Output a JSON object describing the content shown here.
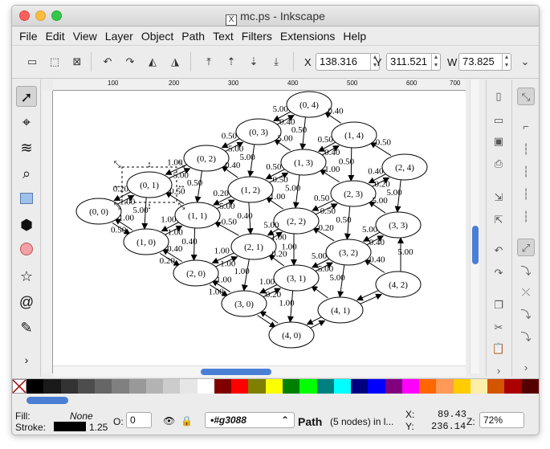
{
  "window": {
    "title": "mc.ps - Inkscape"
  },
  "menu": [
    "File",
    "Edit",
    "View",
    "Layer",
    "Object",
    "Path",
    "Text",
    "Filters",
    "Extensions",
    "Help"
  ],
  "toolbar": {
    "x_label": "X",
    "x_value": "138.316",
    "y_label": "Y",
    "y_value": "311.521",
    "w_label": "W",
    "w_value": "73.825"
  },
  "ruler_ticks": [
    "100",
    "200",
    "300",
    "400",
    "500",
    "600",
    "700"
  ],
  "graph": {
    "nodes": [
      {
        "id": "n04",
        "label": "(0, 4)"
      },
      {
        "id": "n03",
        "label": "(0, 3)"
      },
      {
        "id": "n14",
        "label": "(1, 4)"
      },
      {
        "id": "n02",
        "label": "(0, 2)"
      },
      {
        "id": "n13",
        "label": "(1, 3)"
      },
      {
        "id": "n24",
        "label": "(2, 4)"
      },
      {
        "id": "n01",
        "label": "(0, 1)"
      },
      {
        "id": "n12",
        "label": "(1, 2)"
      },
      {
        "id": "n23",
        "label": "(2, 3)"
      },
      {
        "id": "n00",
        "label": "(0, 0)"
      },
      {
        "id": "n11",
        "label": "(1, 1)"
      },
      {
        "id": "n22",
        "label": "(2, 2)"
      },
      {
        "id": "n33",
        "label": "(3, 3)"
      },
      {
        "id": "n10",
        "label": "(1, 0)"
      },
      {
        "id": "n21",
        "label": "(2, 1)"
      },
      {
        "id": "n32",
        "label": "(3, 2)"
      },
      {
        "id": "n20",
        "label": "(2, 0)"
      },
      {
        "id": "n31",
        "label": "(3, 1)"
      },
      {
        "id": "n42",
        "label": "(4, 2)"
      },
      {
        "id": "n30",
        "label": "(3, 0)"
      },
      {
        "id": "n41",
        "label": "(4, 1)"
      },
      {
        "id": "n40",
        "label": "(4, 0)"
      }
    ],
    "edge_labels": [
      "0.40",
      "5.00",
      "0.50",
      "0.40",
      "5.00",
      "0.50",
      "5.00",
      "5.00",
      "0.50",
      "0.40",
      "0.50",
      "0.50",
      "5.00",
      "1.00",
      "0.50",
      "0.40",
      "0.50",
      "0.50",
      "5.00",
      "1.00",
      "0.40",
      "0.20",
      "5.00",
      "1.00",
      "0.20",
      "5.00",
      "0.50",
      "0.20",
      "5.00",
      "0.40",
      "1.00",
      "0.50",
      "0.50",
      "0.50",
      "5.00",
      "1.00",
      "0.50",
      "1.00",
      "1.00",
      "0.40",
      "0.50",
      "5.00",
      "1.00",
      "1.00",
      "0.20",
      "5.00",
      "0.40",
      "5.00",
      "0.40",
      "0.20",
      "1.00",
      "1.00",
      "1.00",
      "0.20",
      "5.00",
      "5.00",
      "5.00",
      "0.40",
      "1.00",
      "1.00",
      "0.20",
      "1.00",
      "1.00"
    ]
  },
  "statusbar": {
    "fill_label": "Fill:",
    "fill_value": "None",
    "stroke_label": "Stroke:",
    "stroke_width": "1.25",
    "opacity_label": "O:",
    "opacity_value": "0",
    "layer_value": "•#g3088",
    "message_bold": "Path",
    "message_rest": "(5 nodes) in l...",
    "x_label": "X:",
    "x_value": "89.43",
    "y_label": "Y:",
    "y_value": "236.14",
    "zoom_label": "Z:",
    "zoom_value": "72%"
  },
  "palette_colors": [
    "#000000",
    "#1a1a1a",
    "#333333",
    "#4d4d4d",
    "#666666",
    "#808080",
    "#999999",
    "#b3b3b3",
    "#cccccc",
    "#e6e6e6",
    "#ffffff",
    "#800000",
    "#ff0000",
    "#808000",
    "#ffff00",
    "#008000",
    "#00ff00",
    "#008080",
    "#00ffff",
    "#000080",
    "#0000ff",
    "#800080",
    "#ff00ff",
    "#ff6600",
    "#ff9955",
    "#ffcc00",
    "#ffeeaa",
    "#d45500",
    "#aa0000",
    "#550000"
  ]
}
